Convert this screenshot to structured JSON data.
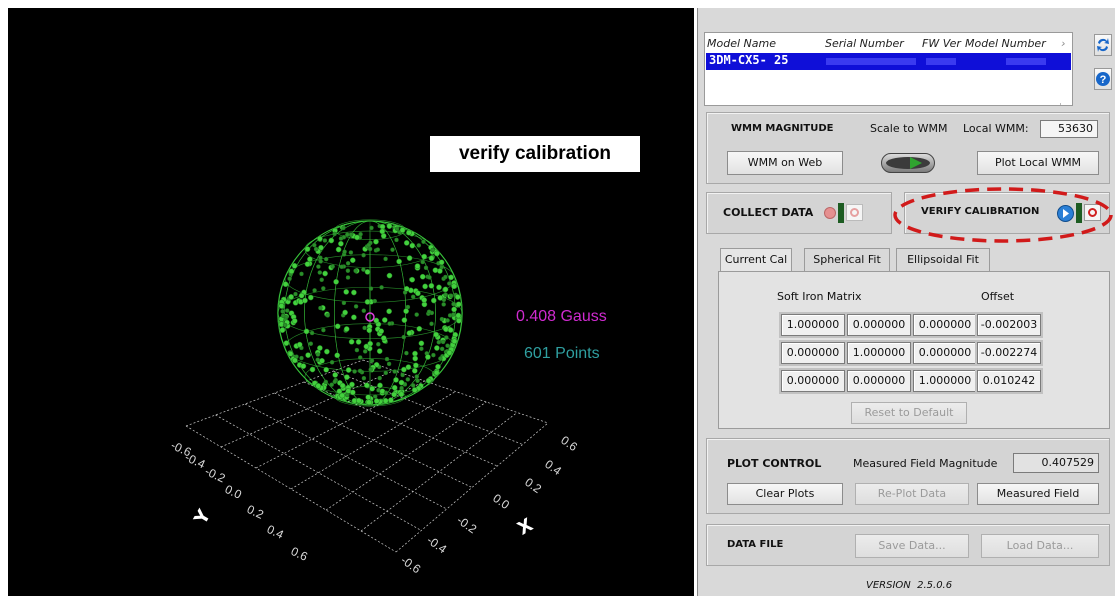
{
  "plot": {
    "annotation": "verify calibration",
    "magnitude_label": "0.408 Gauss",
    "points_label": "601 Points",
    "axis_x_label": "X",
    "axis_y_label": "Y",
    "ticks": [
      "-0.6",
      "-0.4",
      "-0.2",
      "0.0",
      "0.2",
      "0.4",
      "0.6"
    ],
    "colors": {
      "sphere": "#39c83c",
      "gauss": "#d02bd0",
      "points": "#2f9fa0",
      "grid": "#cfcfcf"
    }
  },
  "device_list": {
    "columns": [
      "Model Name",
      "Serial Number",
      "FW Ver",
      "Model Number"
    ],
    "selected_row": {
      "model_name": "3DM-CX5- 25"
    }
  },
  "wmm": {
    "title": "WMM MAGNITUDE",
    "scale_label": "Scale to WMM",
    "local_label": "Local WMM:",
    "local_value": "53630",
    "web_button": "WMM on Web",
    "plot_button": "Plot Local WMM"
  },
  "collect": {
    "title": "COLLECT DATA"
  },
  "verify": {
    "title": "VERIFY CALIBRATION"
  },
  "tabs": [
    "Current Cal",
    "Spherical Fit",
    "Ellipsoidal Fit"
  ],
  "calibration": {
    "matrix_label": "Soft Iron Matrix",
    "offset_label": "Offset",
    "matrix": [
      [
        "1.000000",
        "0.000000",
        "0.000000"
      ],
      [
        "0.000000",
        "1.000000",
        "0.000000"
      ],
      [
        "0.000000",
        "0.000000",
        "1.000000"
      ]
    ],
    "offset": [
      "-0.002003",
      "-0.002274",
      "0.010242"
    ],
    "reset_button": "Reset to Default"
  },
  "plot_control": {
    "title": "PLOT CONTROL",
    "measured_label": "Measured Field Magnitude",
    "measured_value": "0.407529",
    "clear_button": "Clear Plots",
    "replot_button": "Re-Plot Data",
    "measured_button": "Measured Field"
  },
  "data_file": {
    "title": "DATA FILE",
    "save_button": "Save Data...",
    "load_button": "Load Data..."
  },
  "version": "VERSION  2.5.0.6"
}
